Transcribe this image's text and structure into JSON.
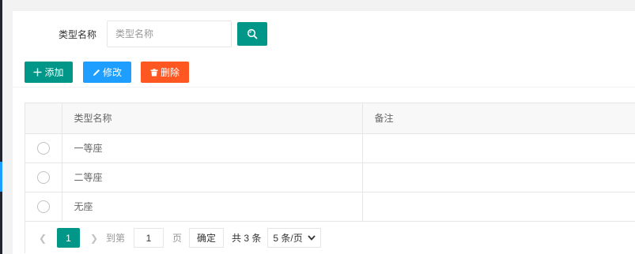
{
  "search": {
    "label": "类型名称",
    "placeholder": "类型名称",
    "value": ""
  },
  "toolbar": {
    "add_label": "添加",
    "edit_label": "修改",
    "delete_label": "删除"
  },
  "table": {
    "columns": [
      "类型名称",
      "备注"
    ],
    "rows": [
      {
        "name": "一等座",
        "remark": ""
      },
      {
        "name": "二等座",
        "remark": ""
      },
      {
        "name": "无座",
        "remark": ""
      }
    ]
  },
  "pagination": {
    "current_page": "1",
    "goto_label": "到第",
    "page_input": "1",
    "page_unit": "页",
    "confirm_label": "确定",
    "total_label": "共 3 条",
    "page_size": "5 条/页"
  },
  "colors": {
    "primary": "#009688",
    "blue": "#1e9fff",
    "danger": "#ff5722"
  }
}
